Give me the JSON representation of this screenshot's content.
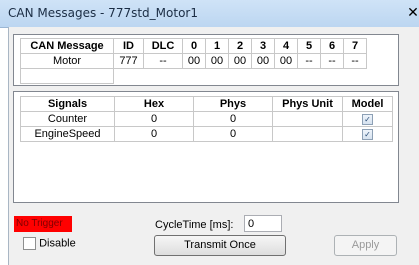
{
  "window": {
    "title": "CAN Messages - 777std_Motor1",
    "close_glyph": "✕"
  },
  "message_table": {
    "headers": [
      "CAN Message",
      "ID",
      "DLC",
      "0",
      "1",
      "2",
      "3",
      "4",
      "5",
      "6",
      "7"
    ],
    "row": [
      "Motor",
      "777",
      "--",
      "00",
      "00",
      "00",
      "00",
      "00",
      "--",
      "--",
      "--"
    ]
  },
  "signals_table": {
    "headers": [
      "Signals",
      "Hex",
      "Phys",
      "Phys Unit",
      "Model"
    ],
    "rows": [
      {
        "name": "Counter",
        "hex": "0",
        "phys": "0",
        "unit": "",
        "model": true
      },
      {
        "name": "EngineSpeed",
        "hex": "0",
        "phys": "0",
        "unit": "",
        "model": true
      }
    ],
    "check_glyph": "✓"
  },
  "footer": {
    "trigger_status": "No Trigger",
    "trigger_color": "#ff0000",
    "disable_label": "Disable",
    "cycle_label": "CycleTime [ms]:",
    "cycle_value": "0",
    "transmit_label": "Transmit Once",
    "apply_label": "Apply"
  }
}
